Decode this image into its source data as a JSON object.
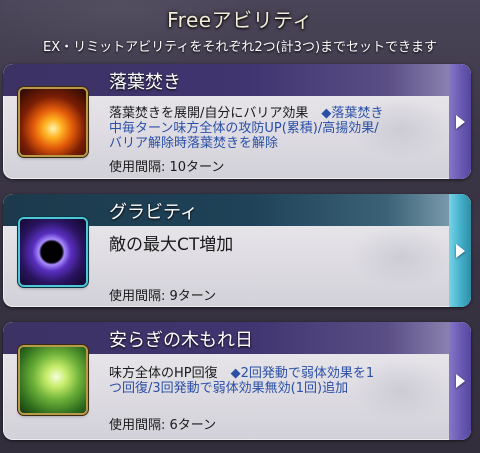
{
  "header": {
    "title": "Freeアビリティ",
    "subtitle": "EX・リミットアビリティをそれぞれ2つ(計3つ)までセットできます"
  },
  "abilities": [
    {
      "name": "落葉焚き",
      "icon": "bonfire-icon",
      "desc_line1": "落葉焚きを展開/自分にバリア効果　",
      "desc_hl1": "◆落葉焚き",
      "desc_line2": "中毎ターン味方全体の攻防UP(累積)/高揚効果/",
      "desc_line3": "バリア解除時落葉焚きを解除",
      "cooldown": "使用間隔: 10ターン",
      "accent": "#403570"
    },
    {
      "name": "グラビティ",
      "icon": "gravity-orb-icon",
      "desc": "敵の最大CT増加",
      "cooldown": "使用間隔: 9ターン",
      "accent": "#1f4258"
    },
    {
      "name": "安らぎの木もれ日",
      "icon": "sunlight-leaves-icon",
      "desc_line1": "味方全体のHP回復　",
      "desc_hl1": "◆2回発動で弱体効果を1",
      "desc_line2": "つ回復/3回発動で弱体効果無効(1回)追加",
      "cooldown": "使用間隔: 6ターン",
      "accent": "#403570"
    }
  ]
}
